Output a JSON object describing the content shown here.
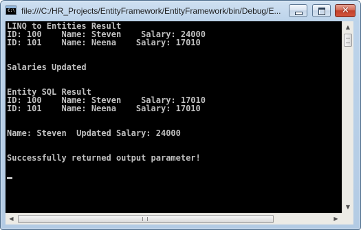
{
  "window": {
    "title": "file:///C:/HR_Projects/EntityFramework/EntityFramework/bin/Debug/E...",
    "icon": "console-app-icon",
    "icon_prompt": "C:\\",
    "buttons": {
      "minimize": "minimize-icon",
      "maximize": "maximize-icon",
      "close_glyph": "✕"
    }
  },
  "console": {
    "lines": [
      "LINQ to Entities Result",
      "ID: 100    Name: Steven    Salary: 24000",
      "ID: 101    Name: Neena    Salary: 17010",
      "",
      "",
      "Salaries Updated",
      "",
      "",
      "Entity SQL Result",
      "ID: 100    Name: Steven    Salary: 17010",
      "ID: 101    Name: Neena    Salary: 17010",
      "",
      "",
      "Name: Steven  Updated Salary: 24000",
      "",
      "",
      "Successfully returned output parameter!"
    ],
    "background": "#000000",
    "foreground": "#c0c0c0"
  },
  "scrollbars": {
    "up_arrow": "▲",
    "down_arrow": "▼",
    "left_arrow": "◀",
    "right_arrow": "▶"
  }
}
